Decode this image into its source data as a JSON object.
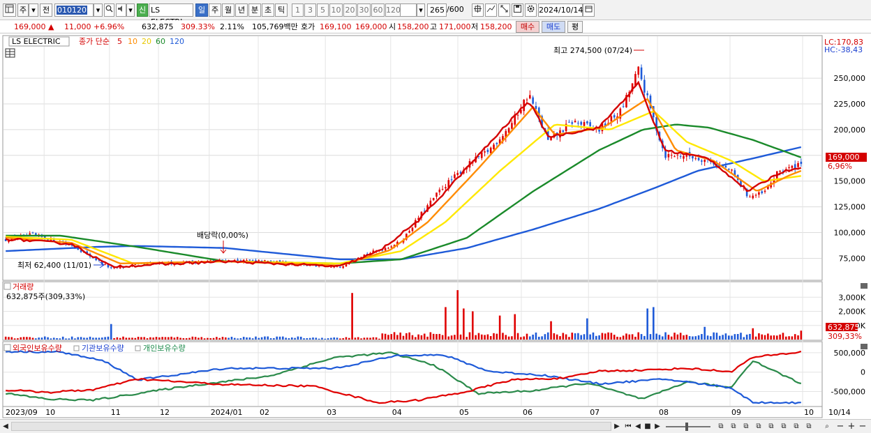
{
  "toolbar": {
    "market": "주",
    "view": "전",
    "code": "010120",
    "name": "LS ELECTRI",
    "new_badge": "신",
    "period_tabs": [
      "일",
      "주",
      "월",
      "년",
      "분",
      "초",
      "틱"
    ],
    "active_period": "일",
    "intervals": [
      "1",
      "3",
      "5",
      "10",
      "20",
      "30",
      "60",
      "120"
    ],
    "count": "265",
    "count_total": "/600",
    "date": "2024/10/14"
  },
  "infobar": {
    "price": "169,000",
    "change_arrow": "▲",
    "change": "11,000",
    "change_pct": "+6.96%",
    "volume": "632,875",
    "volume_ratio": "309.33%",
    "turnover_pct": "2.11%",
    "amount": "105,769백만",
    "quote_label": "호가",
    "bid": "169,100",
    "ask": "169,000",
    "open_label": "시",
    "open": "158,200",
    "high_label": "고",
    "high": "171,000",
    "low_label": "저",
    "low": "158,200",
    "buy_button": "매수",
    "sell_button": "매도",
    "eval_button": "평"
  },
  "price_panel": {
    "legend_name": "LS ELECTRIC",
    "legend_prefix": "종가 단순",
    "ma_periods": [
      "5",
      "10",
      "20",
      "60",
      "120"
    ],
    "ma_colors": [
      "#d40000",
      "#ff8c00",
      "#e8d800",
      "#1a8a2a",
      "#1e5ad8"
    ],
    "lc_label": "LC:170,83",
    "hc_label": "HC:-38,43",
    "high_annotation": "최고 274,500 (07/24)",
    "low_annotation": "최저 62,400 (11/01)",
    "dividend_annotation": "배당락(0,00%)",
    "current_price_tag": "169,000",
    "current_pct_tag": "6,96%"
  },
  "volume_panel": {
    "title": "거래량",
    "subtitle": "632,875주(309,33%)",
    "current_tag": "632,875",
    "current_pct_tag": "309,33%"
  },
  "holdings_panel": {
    "legend": [
      "외국인보유수량",
      "기관보유수량",
      "개인보유수량"
    ],
    "colors": [
      "#d40000",
      "#1e5ad8",
      "#2a8a4a"
    ]
  },
  "bottom": {
    "date_tag": "10/14"
  },
  "chart_data": [
    {
      "type": "candlestick",
      "title": "LS ELECTRIC",
      "ylim": [
        55000,
        290000
      ],
      "y_ticks": [
        75000,
        100000,
        125000,
        150000,
        175000,
        200000,
        225000,
        250000
      ],
      "y_tick_labels": [
        "75,000",
        "100,000",
        "125,000",
        "150,000",
        "175,000",
        "200,000",
        "225,000",
        "250,000"
      ],
      "x_labels": [
        "2023/09",
        "10",
        "11",
        "12",
        "2024/01",
        "02",
        "03",
        "04",
        "05",
        "06",
        "07",
        "08",
        "09",
        "10"
      ],
      "n_bars": 265,
      "close_keyframes": [
        [
          0,
          93000
        ],
        [
          12,
          98000
        ],
        [
          30,
          88000
        ],
        [
          48,
          65000
        ],
        [
          60,
          69000
        ],
        [
          80,
          71000
        ],
        [
          100,
          73000
        ],
        [
          120,
          72000
        ],
        [
          140,
          68000
        ],
        [
          152,
          66000
        ],
        [
          158,
          75000
        ],
        [
          170,
          83000
        ],
        [
          180,
          91000
        ],
        [
          188,
          115000
        ],
        [
          198,
          142000
        ],
        [
          210,
          165000
        ],
        [
          220,
          180000
        ],
        [
          230,
          205000
        ],
        [
          238,
          235000
        ],
        [
          247,
          188000
        ],
        [
          258,
          208000
        ],
        [
          270,
          200000
        ],
        [
          280,
          218000
        ],
        [
          288,
          258000
        ],
        [
          292,
          230000
        ],
        [
          300,
          175000
        ],
        [
          310,
          175000
        ],
        [
          320,
          170000
        ],
        [
          330,
          160000
        ],
        [
          338,
          135000
        ],
        [
          345,
          138000
        ],
        [
          352,
          160000
        ],
        [
          358,
          163000
        ],
        [
          362,
          169000
        ]
      ],
      "ma5_keyframes": [
        [
          0,
          94000
        ],
        [
          30,
          89000
        ],
        [
          48,
          67000
        ],
        [
          100,
          72000
        ],
        [
          152,
          67000
        ],
        [
          170,
          82000
        ],
        [
          188,
          112000
        ],
        [
          210,
          163000
        ],
        [
          238,
          228000
        ],
        [
          247,
          193000
        ],
        [
          270,
          202000
        ],
        [
          288,
          245000
        ],
        [
          300,
          180000
        ],
        [
          320,
          172000
        ],
        [
          338,
          140000
        ],
        [
          352,
          158000
        ],
        [
          362,
          164000
        ]
      ],
      "ma10_keyframes": [
        [
          0,
          95000
        ],
        [
          30,
          90000
        ],
        [
          52,
          70000
        ],
        [
          100,
          72000
        ],
        [
          152,
          68000
        ],
        [
          175,
          83000
        ],
        [
          192,
          110000
        ],
        [
          215,
          162000
        ],
        [
          240,
          222000
        ],
        [
          250,
          195000
        ],
        [
          272,
          202000
        ],
        [
          292,
          230000
        ],
        [
          305,
          180000
        ],
        [
          322,
          170000
        ],
        [
          342,
          140000
        ],
        [
          356,
          155000
        ],
        [
          362,
          160000
        ]
      ],
      "ma20_keyframes": [
        [
          0,
          96000
        ],
        [
          30,
          93000
        ],
        [
          58,
          70000
        ],
        [
          100,
          72000
        ],
        [
          152,
          70000
        ],
        [
          180,
          82000
        ],
        [
          200,
          110000
        ],
        [
          225,
          160000
        ],
        [
          250,
          205000
        ],
        [
          275,
          200000
        ],
        [
          295,
          218000
        ],
        [
          310,
          188000
        ],
        [
          330,
          170000
        ],
        [
          345,
          150000
        ],
        [
          362,
          155000
        ]
      ],
      "ma60_keyframes": [
        [
          0,
          97000
        ],
        [
          25,
          97000
        ],
        [
          60,
          86000
        ],
        [
          100,
          72000
        ],
        [
          152,
          70000
        ],
        [
          180,
          74000
        ],
        [
          210,
          95000
        ],
        [
          240,
          140000
        ],
        [
          270,
          180000
        ],
        [
          290,
          200000
        ],
        [
          305,
          205000
        ],
        [
          320,
          202000
        ],
        [
          340,
          190000
        ],
        [
          362,
          173000
        ]
      ],
      "ma120_keyframes": [
        [
          0,
          82000
        ],
        [
          40,
          86000
        ],
        [
          60,
          87000
        ],
        [
          100,
          85000
        ],
        [
          152,
          74000
        ],
        [
          180,
          74000
        ],
        [
          210,
          85000
        ],
        [
          240,
          103000
        ],
        [
          270,
          123000
        ],
        [
          295,
          143000
        ],
        [
          315,
          160000
        ],
        [
          340,
          172000
        ],
        [
          362,
          183000
        ]
      ]
    },
    {
      "type": "bar",
      "title": "거래량",
      "ylim": [
        0,
        4000000
      ],
      "y_ticks": [
        1000000,
        2000000,
        3000000
      ],
      "y_tick_labels": [
        "1,000K",
        "2,000K",
        "3,000K"
      ],
      "spikes": [
        [
          48,
          1100000
        ],
        [
          158,
          3300000
        ],
        [
          200,
          2300000
        ],
        [
          205,
          3500000
        ],
        [
          208,
          2200000
        ],
        [
          212,
          2000000
        ],
        [
          225,
          1700000
        ],
        [
          232,
          1800000
        ],
        [
          248,
          1300000
        ],
        [
          265,
          1500000
        ],
        [
          292,
          2200000
        ],
        [
          295,
          2300000
        ],
        [
          318,
          900000
        ],
        [
          340,
          800000
        ],
        [
          362,
          632875
        ]
      ]
    },
    {
      "type": "line",
      "title": "외국인보유수량 / 기관보유수량 / 개인보유수량",
      "ylim": [
        -850000,
        750000
      ],
      "y_ticks": [
        -500000,
        0,
        500000
      ],
      "y_tick_labels": [
        "-500,000",
        "0",
        "500,000"
      ],
      "series": [
        {
          "name": "외국인보유수량",
          "keyframes": [
            [
              0,
              -460000
            ],
            [
              20,
              -520000
            ],
            [
              40,
              -450000
            ],
            [
              60,
              -180000
            ],
            [
              100,
              -320000
            ],
            [
              140,
              -360000
            ],
            [
              158,
              -620000
            ],
            [
              170,
              -790000
            ],
            [
              188,
              -720000
            ],
            [
              210,
              -500000
            ],
            [
              230,
              -200000
            ],
            [
              255,
              -150000
            ],
            [
              270,
              30000
            ],
            [
              290,
              50000
            ],
            [
              310,
              100000
            ],
            [
              330,
              10000
            ],
            [
              340,
              380000
            ],
            [
              362,
              520000
            ]
          ]
        },
        {
          "name": "기관보유수량",
          "keyframes": [
            [
              0,
              530000
            ],
            [
              25,
              520000
            ],
            [
              45,
              280000
            ],
            [
              60,
              -200000
            ],
            [
              100,
              100000
            ],
            [
              150,
              100000
            ],
            [
              180,
              450000
            ],
            [
              200,
              430000
            ],
            [
              220,
              20000
            ],
            [
              245,
              -80000
            ],
            [
              270,
              -300000
            ],
            [
              300,
              -180000
            ],
            [
              330,
              -400000
            ],
            [
              340,
              -780000
            ],
            [
              362,
              -790000
            ]
          ]
        },
        {
          "name": "개인보유수량",
          "keyframes": [
            [
              0,
              -550000
            ],
            [
              20,
              -700000
            ],
            [
              40,
              -720000
            ],
            [
              80,
              -380000
            ],
            [
              120,
              -100000
            ],
            [
              150,
              380000
            ],
            [
              175,
              500000
            ],
            [
              195,
              180000
            ],
            [
              215,
              -550000
            ],
            [
              240,
              -480000
            ],
            [
              265,
              -280000
            ],
            [
              290,
              -700000
            ],
            [
              310,
              -250000
            ],
            [
              330,
              -400000
            ],
            [
              340,
              300000
            ],
            [
              362,
              -300000
            ]
          ]
        }
      ]
    }
  ]
}
